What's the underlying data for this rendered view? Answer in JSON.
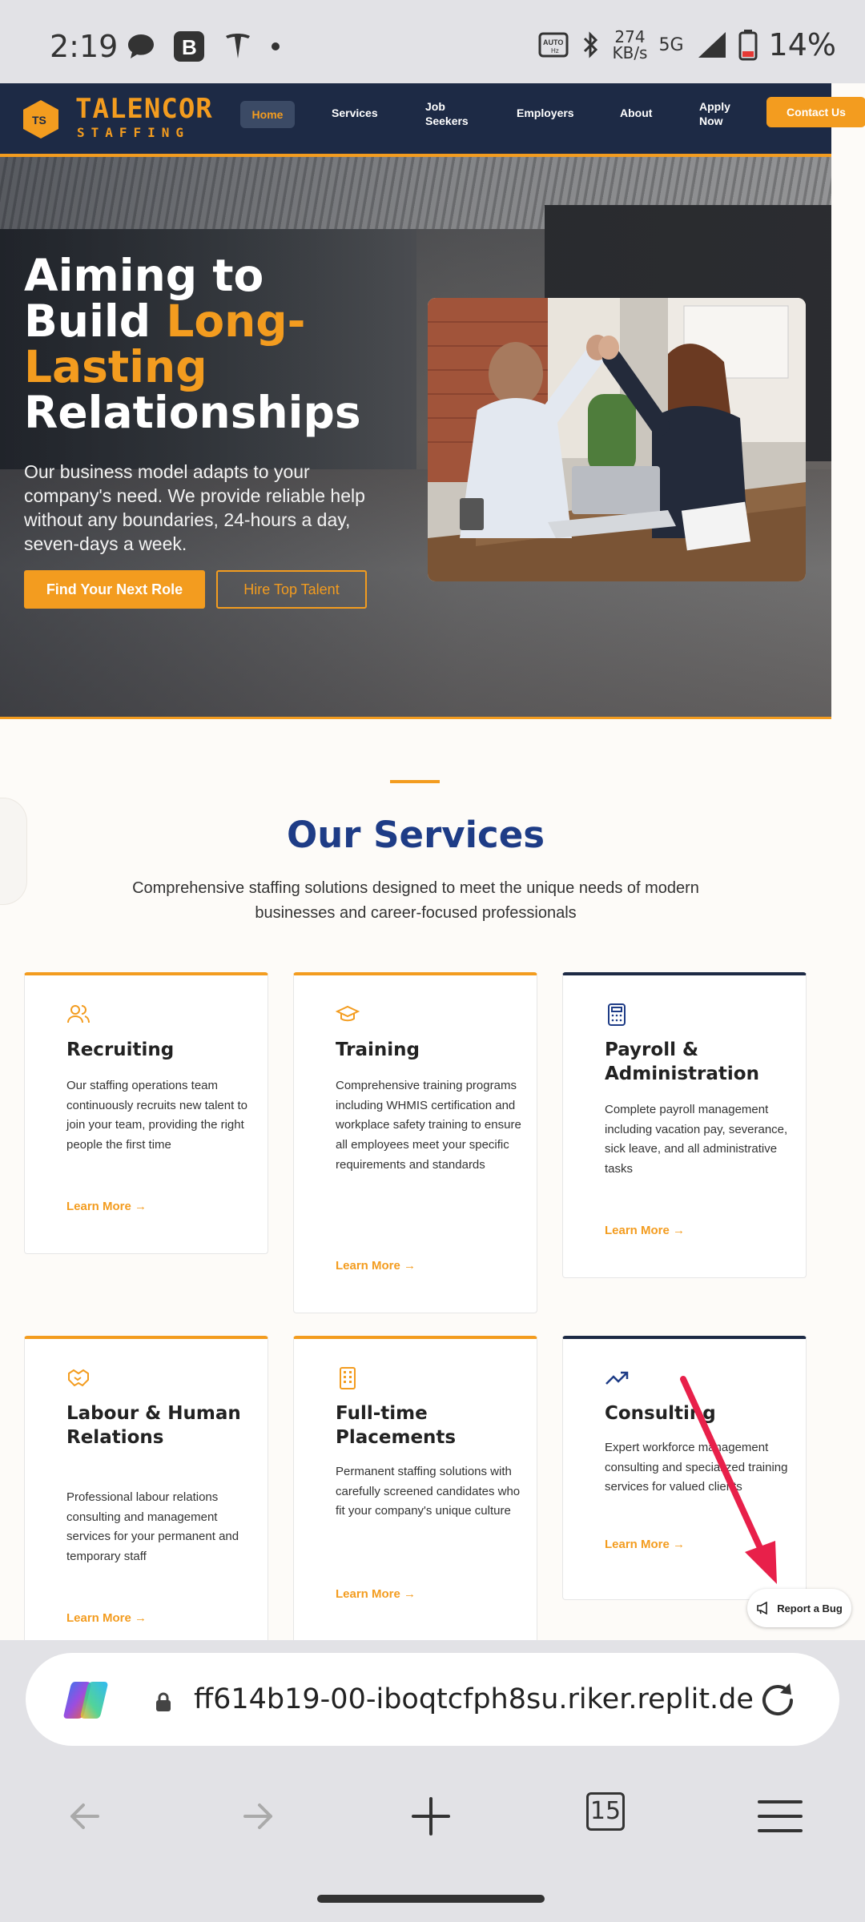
{
  "status_bar": {
    "time": "2:19",
    "speed_value": "274",
    "speed_unit": "KB/s",
    "network": "5G",
    "battery": "14%",
    "auto_label": "AUTO"
  },
  "site": {
    "logo_name": "TALENCOR",
    "logo_sub": "STAFFING",
    "nav": {
      "home": "Home",
      "services": "Services",
      "job_seekers_1": "Job",
      "job_seekers_2": "Seekers",
      "employers": "Employers",
      "about": "About",
      "apply_1": "Apply",
      "apply_2": "Now",
      "contact": "Contact Us"
    },
    "hero": {
      "title_1": "Aiming to",
      "title_2a": "Build ",
      "title_2b": "Long-",
      "title_3": "Lasting",
      "title_4": "Relationships",
      "description": "Our business model adapts to your company's need. We provide reliable help without any boundaries, 24-hours a day, seven-days a week.",
      "primary_cta": "Find Your Next Role",
      "secondary_cta": "Hire Top Talent"
    },
    "services": {
      "title": "Our Services",
      "subtitle": "Comprehensive staffing solutions designed to meet the unique needs of modern businesses and career-focused professionals",
      "cards": [
        {
          "icon": "users-icon",
          "title": "Recruiting",
          "text": "Our staffing operations team continuously recruits new talent to join your team, providing the right people the first time",
          "link": "Learn More →"
        },
        {
          "icon": "graduation-cap-icon",
          "title": "Training",
          "text": "Comprehensive training programs including WHMIS certification and workplace safety training to ensure all employees meet your specific requirements and standards",
          "link": "Learn More →"
        },
        {
          "icon": "calculator-icon",
          "title": "Payroll & Administration",
          "text": "Complete payroll management including vacation pay, severance, sick leave, and all administrative tasks",
          "link": "Learn More →"
        },
        {
          "icon": "handshake-icon",
          "title": "Labour & Human Relations",
          "text": "Professional labour relations consulting and management services for your permanent and temporary staff",
          "link": "Learn More →"
        },
        {
          "icon": "building-icon",
          "title": "Full-time Placements",
          "text": "Permanent staffing solutions with carefully screened candidates who fit your company's unique culture",
          "link": "Learn More →"
        },
        {
          "icon": "trending-up-icon",
          "title": "Consulting",
          "text": "Expert workforce management consulting and specialized training services for valued clients",
          "link": "Learn More →"
        }
      ]
    },
    "report_bug": "Report a Bug"
  },
  "browser": {
    "url": "ff614b19-00-iboqtcfph8su.riker.replit.de",
    "tab_count": "15"
  },
  "colors": {
    "navy": "#1d2a45",
    "orange": "#f39c1f",
    "title_blue": "#1e3c86",
    "annotation_red": "#e8204a"
  }
}
